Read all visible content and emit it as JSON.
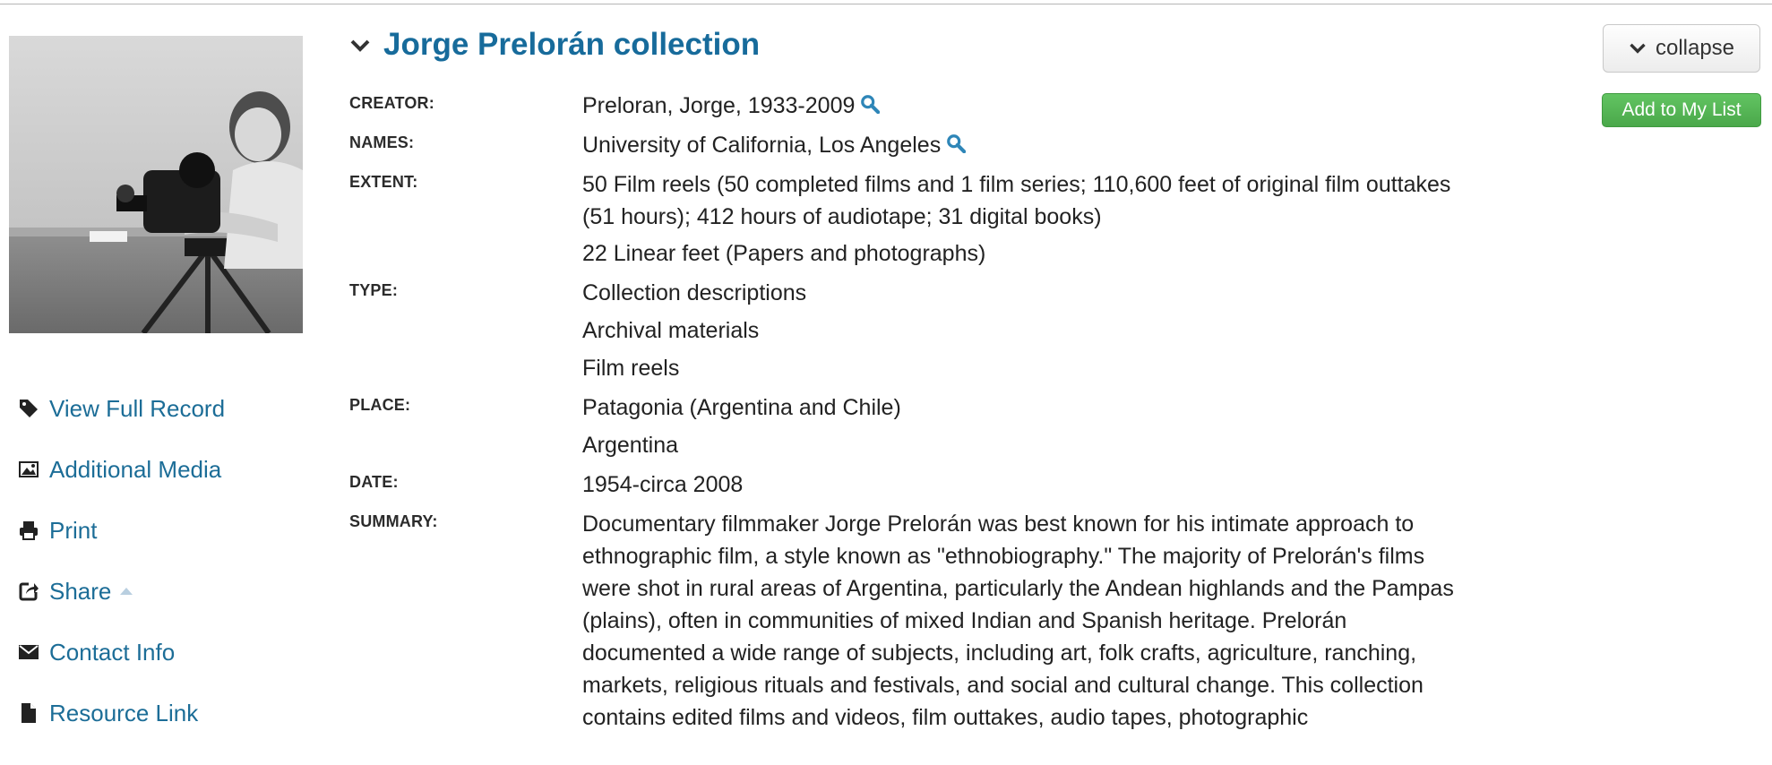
{
  "record": {
    "title": "Jorge Prelorán collection",
    "image_alt": "Photograph of Jorge Prelorán with a film camera on a tripod",
    "fields": [
      {
        "label": "CREATOR:",
        "values": [
          "Preloran, Jorge, 1933-2009"
        ],
        "search": true
      },
      {
        "label": "NAMES:",
        "values": [
          "University of California, Los Angeles"
        ],
        "search": true
      },
      {
        "label": "EXTENT:",
        "values": [
          "50 Film reels (50 completed films and 1 film series; 110,600 feet of original film outtakes (51 hours); 412 hours of audiotape; 31 digital books)",
          "22 Linear feet (Papers and photographs)"
        ],
        "search": false
      },
      {
        "label": "TYPE:",
        "values": [
          "Collection descriptions",
          "Archival materials",
          "Film reels"
        ],
        "search": false
      },
      {
        "label": "PLACE:",
        "values": [
          "Patagonia (Argentina and Chile)",
          "Argentina"
        ],
        "search": false
      },
      {
        "label": "DATE:",
        "values": [
          "1954-circa 2008"
        ],
        "search": false
      },
      {
        "label": "SUMMARY:",
        "values": [
          "Documentary filmmaker Jorge Prelorán was best known for his intimate approach to ethnographic film, a style known as \"ethnobiography.\" The majority of Prelorán's films were shot in rural areas of Argentina, particularly the Andean highlands and the Pampas (plains), often in communities of mixed Indian and Spanish heritage. Prelorán documented a wide range of subjects, including art, folk crafts, agriculture, ranching, markets, religious rituals and festivals, and social and cultural change. This collection contains edited films and videos, film outtakes, audio tapes, photographic"
        ],
        "search": false
      }
    ]
  },
  "actions": [
    {
      "name": "view-full-record",
      "label": "View Full Record",
      "icon": "tag-icon"
    },
    {
      "name": "additional-media",
      "label": "Additional Media",
      "icon": "image-icon"
    },
    {
      "name": "print",
      "label": "Print",
      "icon": "print-icon"
    },
    {
      "name": "share",
      "label": "Share",
      "icon": "share-icon"
    },
    {
      "name": "contact-info",
      "label": "Contact Info",
      "icon": "envelope-icon"
    },
    {
      "name": "resource-link",
      "label": "Resource Link",
      "icon": "file-icon"
    }
  ],
  "buttons": {
    "collapse": "collapse",
    "add_to_list": "Add to My List"
  },
  "colors": {
    "link": "#1c6d97",
    "title": "#176b9b",
    "add_button": "#52b352",
    "search_icon": "#2e86b8"
  }
}
